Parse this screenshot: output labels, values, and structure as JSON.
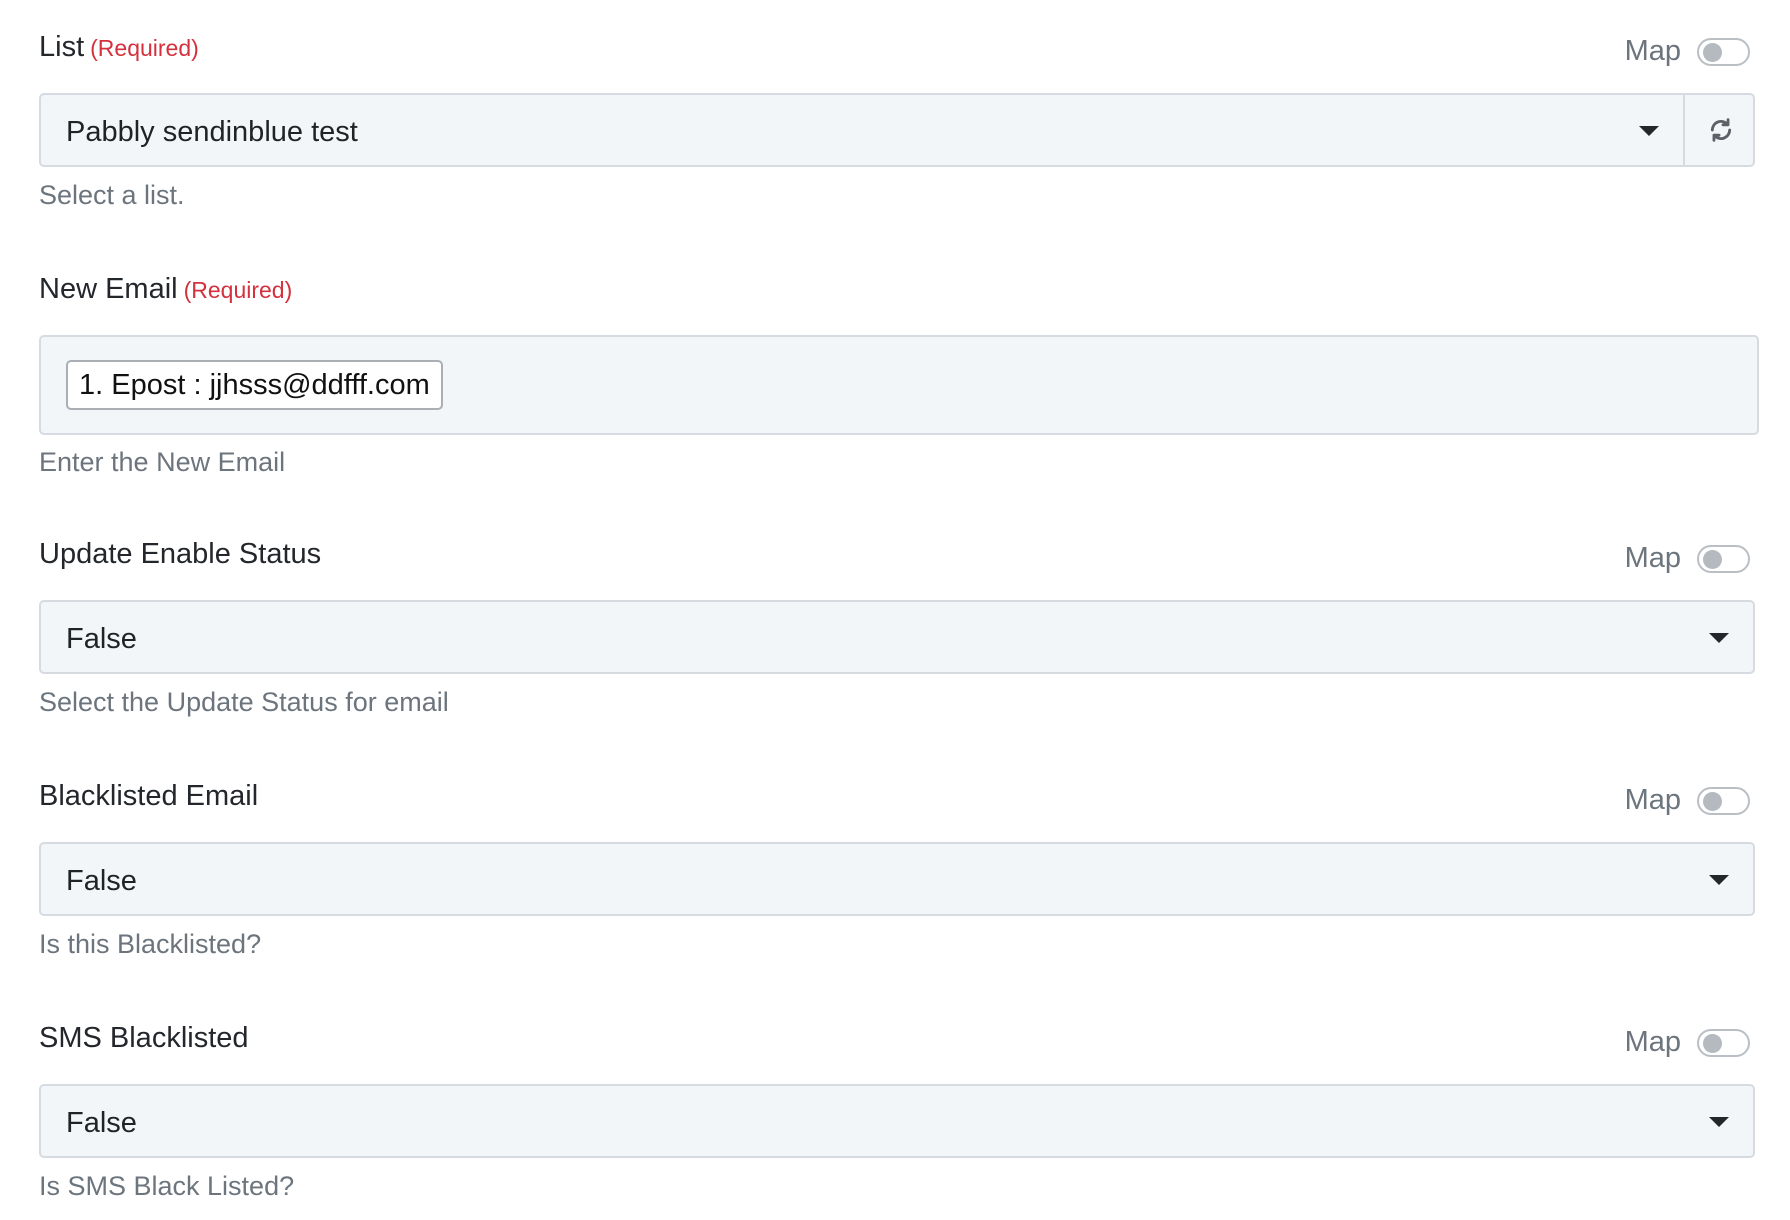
{
  "fields": {
    "list": {
      "label": "List",
      "required": "(Required)",
      "map_label": "Map",
      "map_enabled": false,
      "value": "Pabbly sendinblue test",
      "help": "Select a list."
    },
    "new_email": {
      "label": "New Email",
      "required": "(Required)",
      "chip": "1. Epost : jjhsss@ddfff.com",
      "help": "Enter the New Email"
    },
    "update_enable_status": {
      "label": "Update Enable Status",
      "map_label": "Map",
      "map_enabled": false,
      "value": "False",
      "help": "Select the Update Status for email"
    },
    "blacklisted_email": {
      "label": "Blacklisted Email",
      "map_label": "Map",
      "map_enabled": false,
      "value": "False",
      "help": "Is this Blacklisted?"
    },
    "sms_blacklisted": {
      "label": "SMS Blacklisted",
      "map_label": "Map",
      "map_enabled": false,
      "value": "False",
      "help": "Is SMS Black Listed?"
    }
  },
  "colors": {
    "required": "#d3313d",
    "input_bg": "#f3f6f9",
    "border": "#d5dbe0",
    "help_text": "#6c757d"
  },
  "icons": {
    "refresh": "refresh-icon",
    "caret": "caret-down-icon"
  }
}
